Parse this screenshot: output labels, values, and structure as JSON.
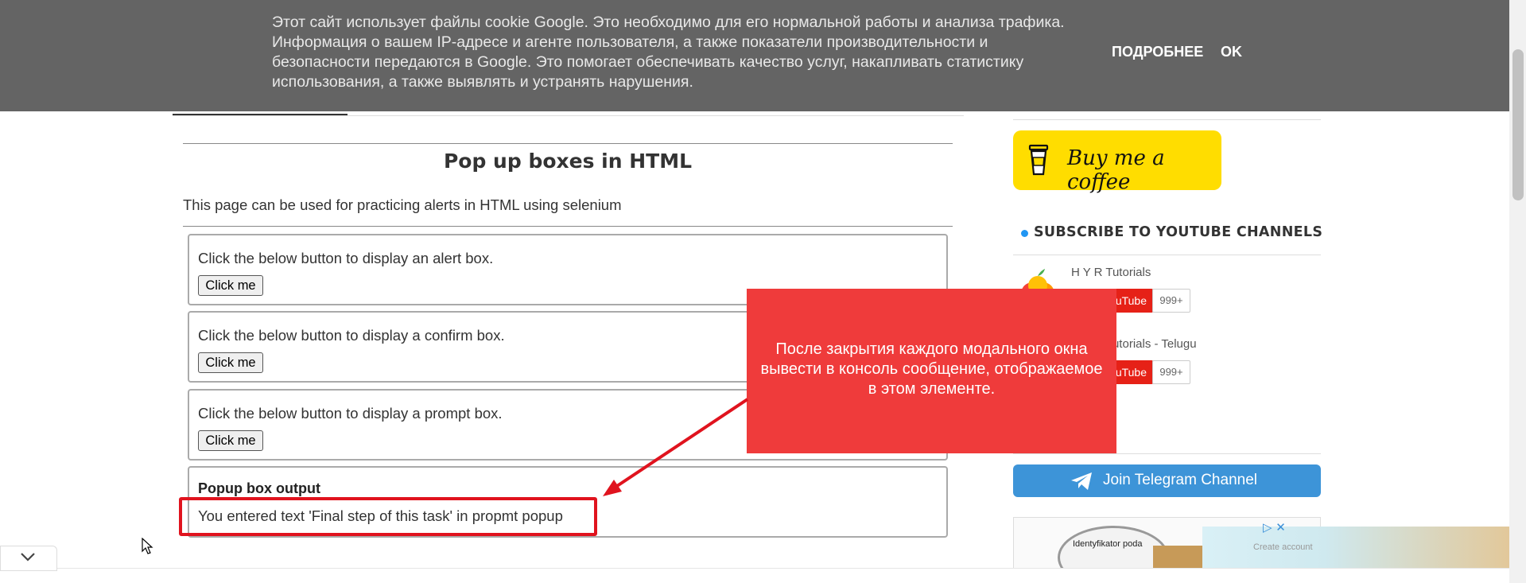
{
  "cookie_banner": {
    "text": "Этот сайт использует файлы cookie Google. Это необходимо для его нормальной работы и анализа трафика. Информация о вашем IP-адресе и агенте пользователя, а также показатели производительности и безопасности передаются в Google. Это помогает обеспечивать качество услуг, накапливать статистику использования, а также выявлять и устранять нарушения.",
    "more_label": "ПОДРОБНЕЕ",
    "ok_label": "OK"
  },
  "main": {
    "title": "Pop up boxes in HTML",
    "description": "This page can be used for practicing alerts in HTML using selenium",
    "boxes": [
      {
        "label": "Click the below button to display an alert box.",
        "button": "Click me"
      },
      {
        "label": "Click the below button to display a confirm box.",
        "button": "Click me"
      },
      {
        "label": "Click the below button to display a prompt box.",
        "button": "Click me"
      }
    ],
    "output": {
      "title": "Popup box output",
      "text": "You entered text 'Final step of this task' in propmt popup"
    }
  },
  "annotation": {
    "text": "После закрытия каждого модального окна вывести в консоль сообщение, отображаемое в этом элементе.",
    "color": "#ef3b3b"
  },
  "sidebar": {
    "coffee_label": "Buy me a coffee",
    "subscribe_title": "SUBSCRIBE TO YOUTUBE CHANNELS",
    "channels": [
      {
        "name": "H Y R Tutorials",
        "button": "YouTube",
        "count": "999+"
      },
      {
        "name": "H Y R Tutorials - Telugu",
        "button": "YouTube",
        "count": "999+"
      }
    ],
    "telegram_label": "Join Telegram Channel",
    "ad": {
      "text": "Identyfikator poda",
      "right_text": "Create account"
    }
  },
  "colors": {
    "cookie_bg": "#646464",
    "coffee_bg": "#ffdd00",
    "telegram_bg": "#3d94d8",
    "youtube_red": "#e62117",
    "highlight_red": "#e0131e"
  }
}
